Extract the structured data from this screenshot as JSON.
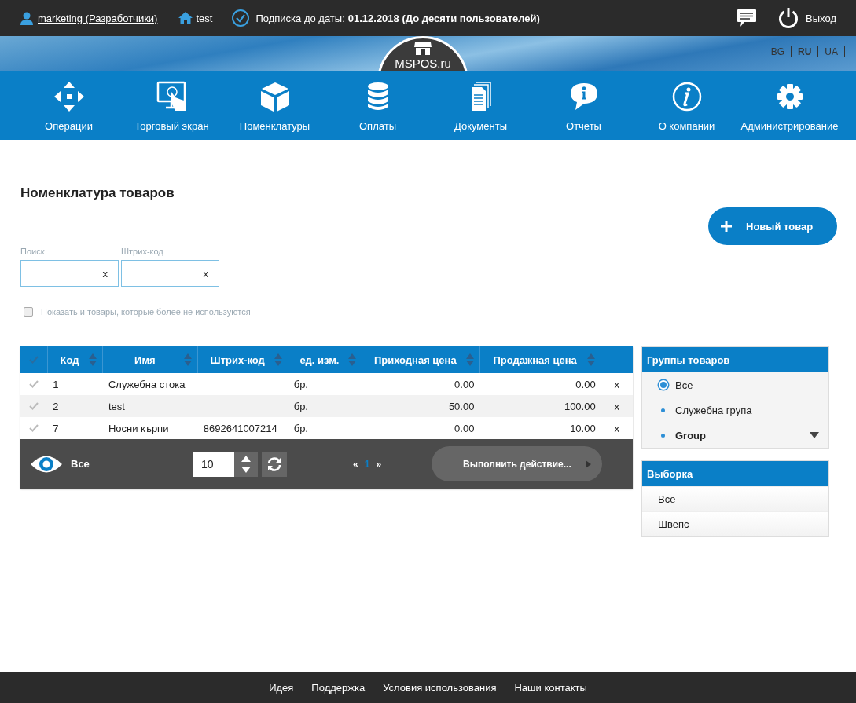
{
  "top_bar": {
    "user": "marketing (Разработчики)",
    "home": "test",
    "subscription_label": "Подписка до даты:",
    "subscription_value": "01.12.2018 (До десяти пользователей)",
    "logout": "Выход"
  },
  "logo": "MSPOS.ru",
  "languages": [
    {
      "label": "BG",
      "selected": false
    },
    {
      "label": "RU",
      "selected": true
    },
    {
      "label": "UA",
      "selected": false
    }
  ],
  "nav": [
    {
      "label": "Операции",
      "kind": "arrows"
    },
    {
      "label": "Торговый экран",
      "kind": "touch"
    },
    {
      "label": "Номенклатуры",
      "kind": "box"
    },
    {
      "label": "Оплаты",
      "kind": "database"
    },
    {
      "label": "Документы",
      "kind": "documents"
    },
    {
      "label": "Отчеты",
      "kind": "bubble"
    },
    {
      "label": "О компании",
      "kind": "info"
    },
    {
      "label": "Администрирование",
      "kind": "gear"
    }
  ],
  "page_title": "Номенклатура товаров",
  "new_button": "Новый товар",
  "filters": [
    {
      "label": "Поиск",
      "clear": "x"
    },
    {
      "label": "Штрих-код",
      "clear": "x"
    }
  ],
  "show_unused": {
    "label": "Показать и товары, которые более не используются",
    "checked": false
  },
  "table": {
    "columns": [
      "Код",
      "Имя",
      "Штрих-код",
      "ед. изм.",
      "Приходная цена",
      "Продажная цена"
    ],
    "rows": [
      {
        "selected": false,
        "code": "1",
        "name": "Служебна стока",
        "barcode": "",
        "unit": "бр.",
        "purchase": "0.00",
        "sale": "0.00",
        "delete": "x"
      },
      {
        "selected": false,
        "code": "2",
        "name": "test",
        "barcode": "",
        "unit": "бр.",
        "purchase": "50.00",
        "sale": "100.00",
        "delete": "x"
      },
      {
        "selected": false,
        "code": "7",
        "name": "Носни кърпи",
        "barcode": "8692641007214",
        "unit": "бр.",
        "purchase": "0.00",
        "sale": "10.00",
        "delete": "x"
      }
    ],
    "footer": {
      "view": "Все",
      "page_size": "10",
      "prev": "«",
      "pages": [
        {
          "label": "1",
          "selected": true
        }
      ],
      "next": "»",
      "action": "Выполнить действие..."
    }
  },
  "groups": {
    "title": "Группы товаров",
    "items": [
      {
        "label": "Все",
        "selected": true,
        "expandable": false
      },
      {
        "label": "Служебна група",
        "selected": false,
        "expandable": false
      },
      {
        "label": "Group",
        "selected": false,
        "expandable": true
      }
    ]
  },
  "selection": {
    "title": "Выборка",
    "items": [
      "Все",
      "Швепс"
    ]
  },
  "footer_links": [
    "Идея",
    "Поддержка",
    "Условия использования",
    "Наши контакты"
  ]
}
